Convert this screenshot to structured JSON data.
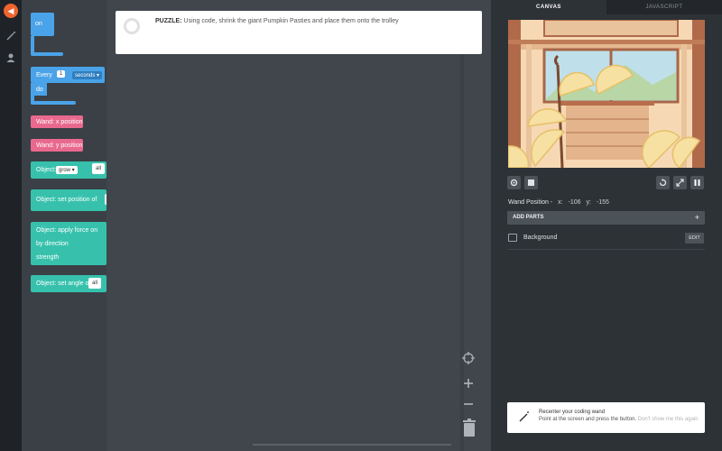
{
  "palette": {
    "on_label": "on",
    "every_label": "Every",
    "every_value": "1",
    "every_unit": "seconds",
    "do_label": "do",
    "wand_x": "Wand: x position",
    "wand_y": "Wand: y position",
    "object_label": "Object:",
    "grow_option": "grow",
    "all_option": "all",
    "set_position": "Object: set position of",
    "apply_force": "Object: apply force on",
    "by_direction": "by direction",
    "strength": "strength",
    "set_angle": "Object: set angle of",
    "set_angle_value": "all"
  },
  "puzzle": {
    "prefix": "PUZZLE:",
    "text": "Using code, shrink the giant Pumpkin Pasties and place them onto the trolley"
  },
  "tabs": {
    "canvas": "CANVAS",
    "javascript": "JAVASCRIPT"
  },
  "wand": {
    "label": "Wand Position -",
    "x_label": "x:",
    "x_value": "-106",
    "y_label": "y:",
    "y_value": "-155"
  },
  "parts": {
    "add_label": "ADD PARTS",
    "add_icon": "+",
    "background_label": "Background",
    "edit_label": "EDIT"
  },
  "toast": {
    "title": "Recenter your coding wand",
    "body": "Point at the screen and press the button.",
    "dismiss": "Don't show me this again"
  },
  "colors": {
    "accent": "#f0642e",
    "event": "#4aa3e8",
    "sensor": "#e9698e",
    "action": "#37c1ad"
  }
}
